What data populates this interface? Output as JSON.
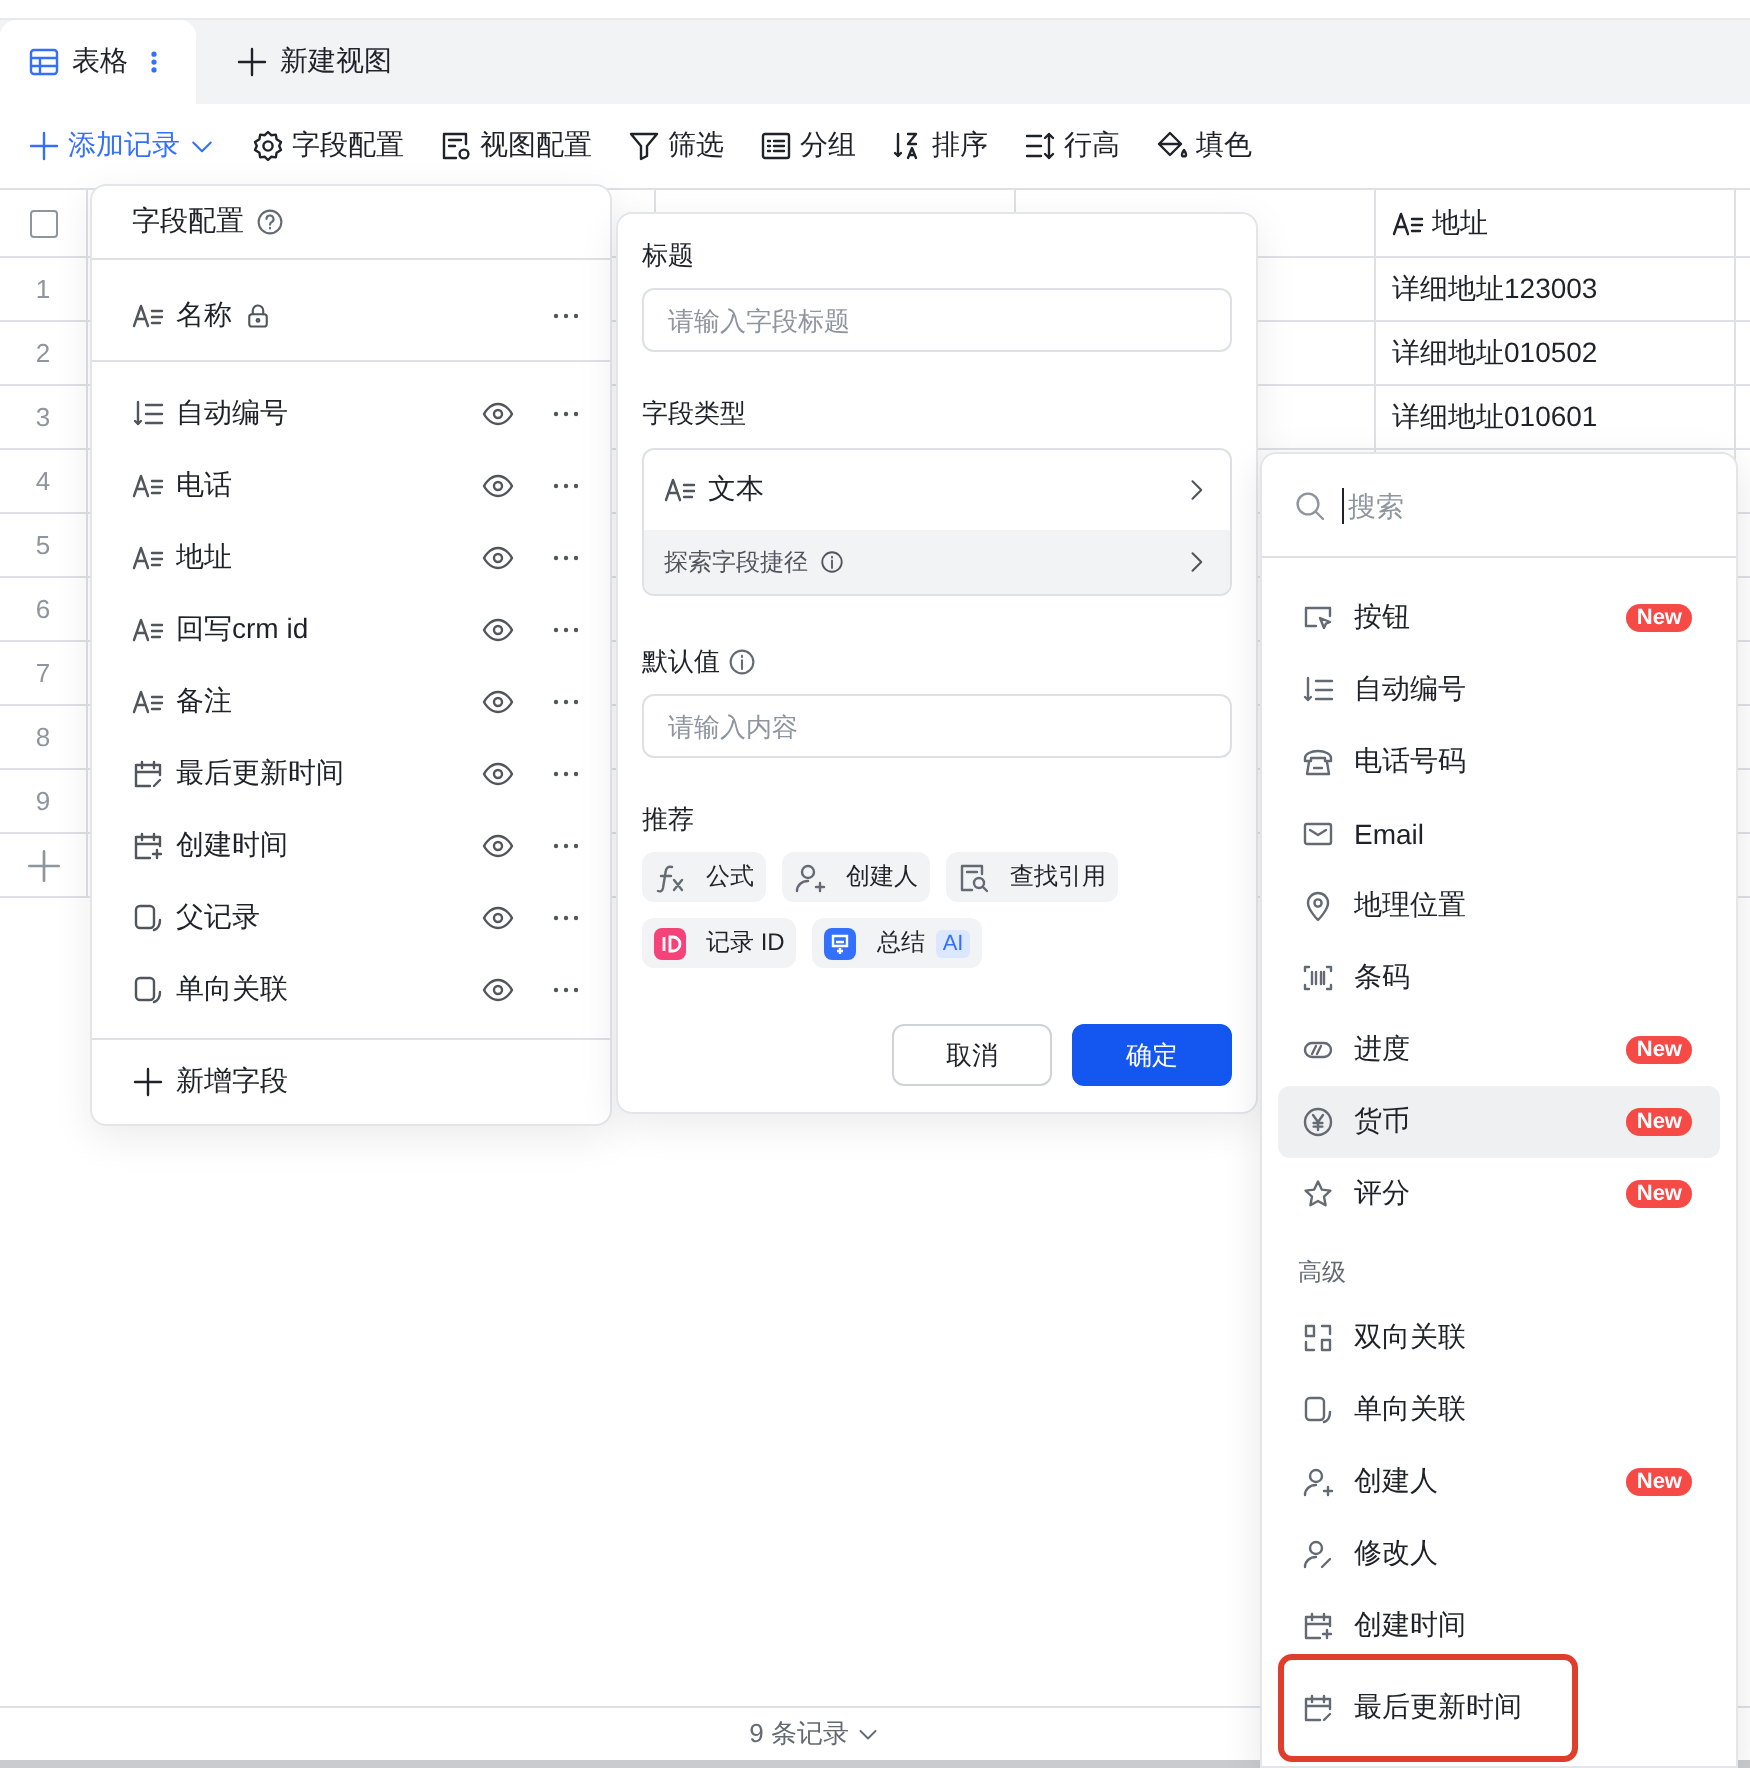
{
  "views": [
    {
      "label": "表格",
      "selected": true
    }
  ],
  "new_view": "新建视图",
  "toolbar": {
    "add_record": "添加记录",
    "tools": [
      "字段配置",
      "视图配置",
      "筛选",
      "分组",
      "排序",
      "行高",
      "填色"
    ]
  },
  "table": {
    "select_all_checked": false,
    "columns": [
      {
        "label": "地址"
      }
    ],
    "rows": [
      {
        "number": "1",
        "address": "详细地址123003"
      },
      {
        "number": "2",
        "address": "详细地址010502"
      },
      {
        "number": "3",
        "address": "详细地址010601"
      },
      {
        "number": "4"
      },
      {
        "number": "5"
      },
      {
        "number": "6"
      },
      {
        "number": "7"
      },
      {
        "number": "8"
      },
      {
        "number": "9"
      }
    ]
  },
  "footer": "9 条记录",
  "field_config": {
    "title": "字段配置",
    "fields": [
      {
        "name": "名称",
        "locked": true
      },
      {
        "name": "自动编号",
        "locked": false
      },
      {
        "name": "电话",
        "locked": false
      },
      {
        "name": "地址",
        "locked": false
      },
      {
        "name": "回写crm id",
        "locked": false
      },
      {
        "name": "备注",
        "locked": false
      },
      {
        "name": "最后更新时间",
        "locked": false
      },
      {
        "name": "创建时间",
        "locked": false
      },
      {
        "name": "父记录",
        "locked": false
      },
      {
        "name": "单向关联",
        "locked": false
      }
    ],
    "add": "新增字段"
  },
  "field_editor": {
    "title_label": "标题",
    "title_placeholder": "请输入字段标题",
    "type_label": "字段类型",
    "type_value": "文本",
    "shortcut": "探索字段捷径",
    "default_label": "默认值",
    "default_placeholder": "请输入内容",
    "recommend_label": "推荐",
    "chips": [
      {
        "label": "公式"
      },
      {
        "label": "创建人"
      },
      {
        "label": "查找引用"
      },
      {
        "label": "记录 ID"
      },
      {
        "label": "总结",
        "badge": "AI"
      }
    ],
    "cancel": "取消",
    "confirm": "确定"
  },
  "type_menu": {
    "search_placeholder": "搜索",
    "items": [
      {
        "kind": "item",
        "label": "按钮",
        "badge": "New",
        "selected": false,
        "highlighted": false
      },
      {
        "kind": "item",
        "label": "自动编号",
        "selected": false,
        "highlighted": false
      },
      {
        "kind": "item",
        "label": "电话号码",
        "selected": false,
        "highlighted": false
      },
      {
        "kind": "item",
        "label": "Email",
        "selected": false,
        "highlighted": false
      },
      {
        "kind": "item",
        "label": "地理位置",
        "selected": false,
        "highlighted": false
      },
      {
        "kind": "item",
        "label": "条码",
        "selected": false,
        "highlighted": false
      },
      {
        "kind": "item",
        "label": "进度",
        "badge": "New",
        "selected": false,
        "highlighted": false
      },
      {
        "kind": "item",
        "label": "货币",
        "badge": "New",
        "selected": true,
        "highlighted": false
      },
      {
        "kind": "item",
        "label": "评分",
        "badge": "New",
        "selected": false,
        "highlighted": false
      },
      {
        "kind": "header",
        "label": "高级"
      },
      {
        "kind": "item",
        "label": "双向关联",
        "selected": false,
        "highlighted": false
      },
      {
        "kind": "item",
        "label": "单向关联",
        "selected": false,
        "highlighted": false
      },
      {
        "kind": "item",
        "label": "创建人",
        "badge": "New",
        "selected": false,
        "highlighted": false
      },
      {
        "kind": "item",
        "label": "修改人",
        "selected": false,
        "highlighted": false
      },
      {
        "kind": "item",
        "label": "创建时间",
        "selected": false,
        "highlighted": false
      },
      {
        "kind": "item",
        "label": "最后更新时间",
        "selected": false,
        "highlighted": true
      }
    ]
  }
}
